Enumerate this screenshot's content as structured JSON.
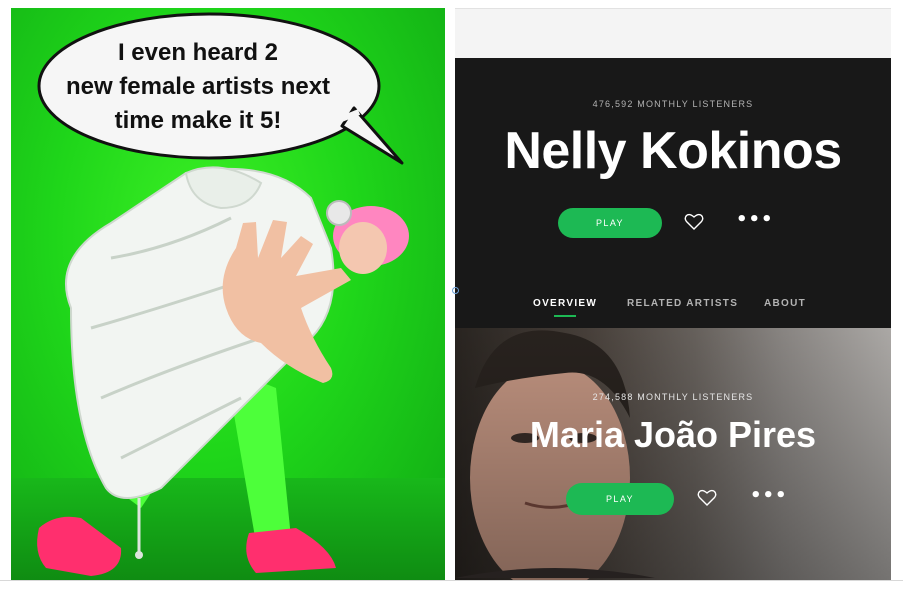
{
  "meme": {
    "caption_lines": [
      "I even heard 2",
      "new female artists next",
      "time make it 5!"
    ]
  },
  "artists": [
    {
      "monthly_listeners": "476,592 MONTHLY LISTENERS",
      "name": "Nelly Kokinos",
      "play_label": "PLAY",
      "more_label": "•••"
    },
    {
      "monthly_listeners": "274,588 MONTHLY LISTENERS",
      "name": "Maria João Pires",
      "play_label": "PLAY",
      "more_label": "•••"
    }
  ],
  "tabs": [
    {
      "label": "OVERVIEW",
      "active": true
    },
    {
      "label": "RELATED ARTISTS",
      "active": false
    },
    {
      "label": "ABOUT",
      "active": false
    }
  ],
  "colors": {
    "spotify_green": "#1db954",
    "background_green": "#1fd61a",
    "dark_bg": "#181818"
  },
  "icons": [
    "heart-icon",
    "more-options-icon"
  ]
}
